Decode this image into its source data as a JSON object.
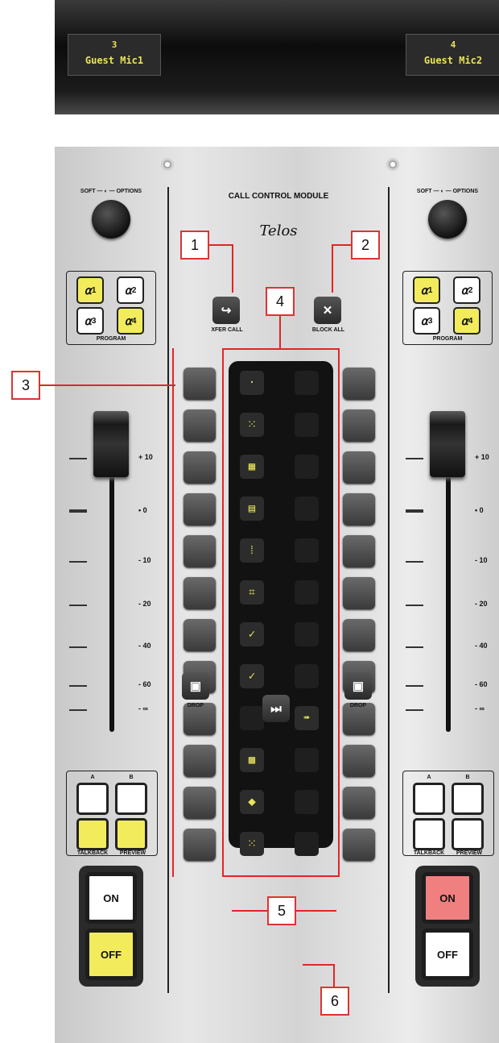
{
  "lcd": {
    "left": {
      "number": "3",
      "name": "Guest Mic1"
    },
    "right": {
      "number": "4",
      "name": "Guest Mic2"
    }
  },
  "module": {
    "title": "CALL CONTROL MODULE",
    "brand": "Telos",
    "xfer_label": "XFER CALL",
    "block_label": "BLOCK ALL",
    "drop_label": "DROP",
    "next_label": "NEXT"
  },
  "strip": {
    "soft_options": "SOFT — ◐ — OPTIONS",
    "program_label": "PROGRAM",
    "program_buttons": [
      "1",
      "2",
      "3",
      "4"
    ],
    "scale": [
      "+ 10",
      "• 0",
      "- 10",
      "- 20",
      "- 40",
      "- 60",
      "- ∞"
    ],
    "a_label": "A",
    "b_label": "B",
    "talkback_label": "TALKBACK",
    "preview_label": "PREVIEW",
    "on_label": "ON",
    "off_label": "OFF"
  },
  "callouts": [
    "1",
    "2",
    "3",
    "4",
    "5",
    "6"
  ],
  "colors": {
    "yellow": "#f2ec5c",
    "red_on": "#f08080",
    "callout_red": "#e12626",
    "led": "#e8e35a"
  }
}
